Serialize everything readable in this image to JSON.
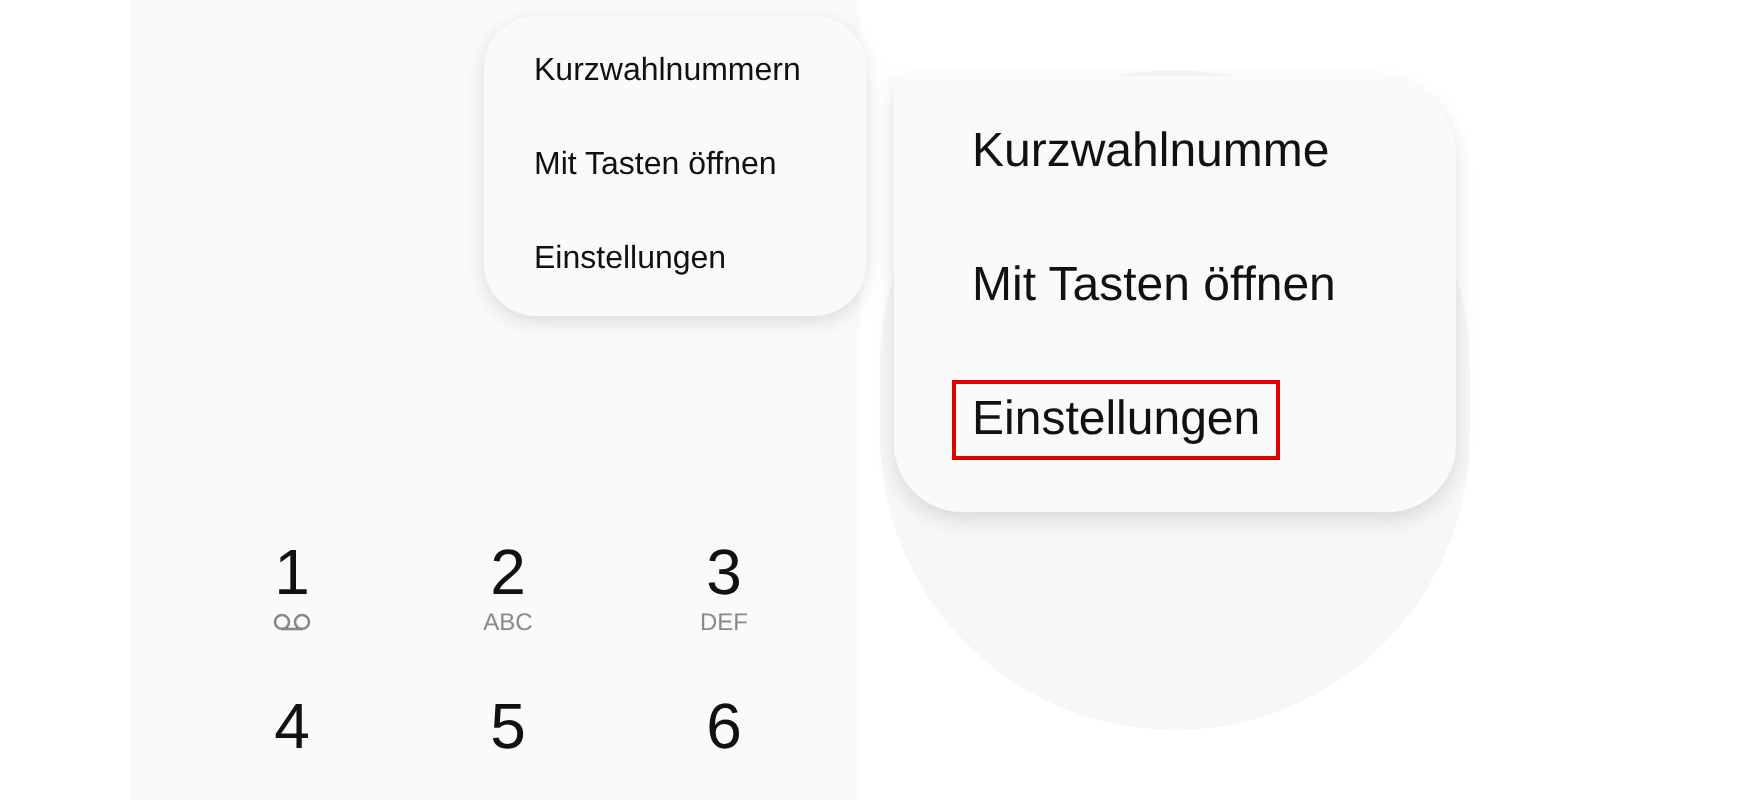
{
  "menu": {
    "items": [
      {
        "label": "Kurzwahlnummern"
      },
      {
        "label": "Mit Tasten öffnen"
      },
      {
        "label": "Einstellungen"
      }
    ]
  },
  "magnifier": {
    "items": [
      {
        "label": "Kurzwahlnumme",
        "highlighted": false
      },
      {
        "label": "Mit Tasten öffnen",
        "highlighted": false
      },
      {
        "label": "Einstellungen",
        "highlighted": true
      }
    ]
  },
  "dialpad": {
    "keys": [
      {
        "digit": "1",
        "kind": "voicemail"
      },
      {
        "digit": "2",
        "letters": "ABC",
        "kind": "letters"
      },
      {
        "digit": "3",
        "letters": "DEF",
        "kind": "letters"
      },
      {
        "digit": "4",
        "kind": "plain"
      },
      {
        "digit": "5",
        "kind": "plain"
      },
      {
        "digit": "6",
        "kind": "plain"
      }
    ]
  }
}
